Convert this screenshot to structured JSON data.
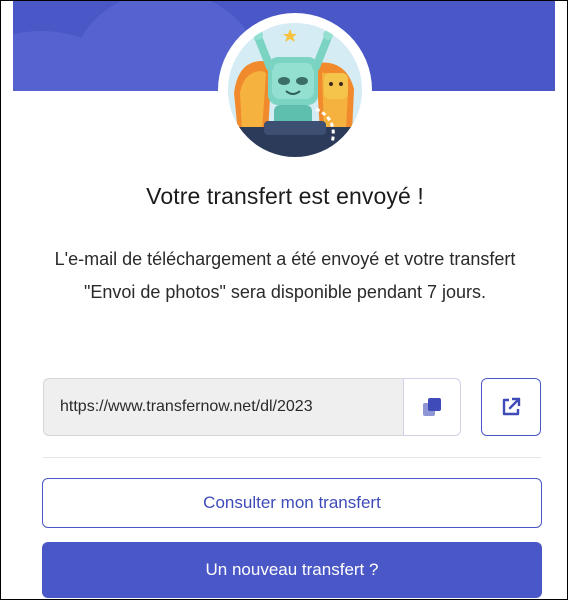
{
  "dialog": {
    "title": "Votre transfert est envoyé !",
    "message": "L'e-mail de téléchargement a été envoyé et votre transfert \"Envoi de photos\" sera disponible pendant 7 jours."
  },
  "link": {
    "value": "https://www.transfernow.net/dl/2023",
    "copy_icon": "copy-icon",
    "open_icon": "external-link-icon"
  },
  "actions": {
    "view_transfer_label": "Consulter mon transfert",
    "new_transfer_label": "Un nouveau transfert ?"
  },
  "colors": {
    "brand": "#4a57c6",
    "background": "#ffffff",
    "field_background": "#efefef"
  }
}
